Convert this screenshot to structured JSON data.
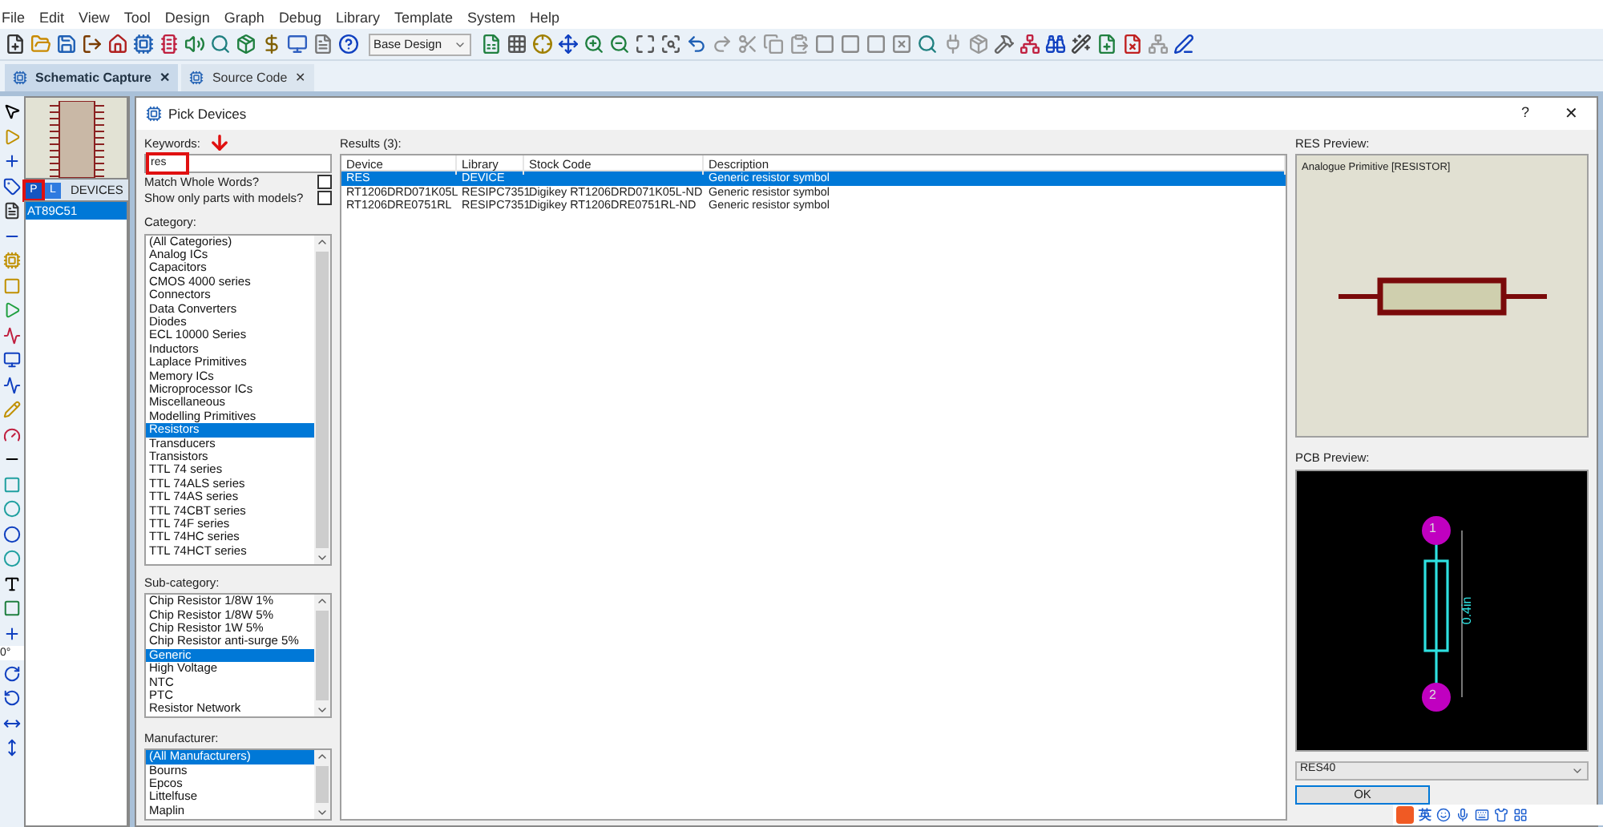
{
  "menu": [
    {
      "label": "File"
    },
    {
      "label": "Edit"
    },
    {
      "label": "View"
    },
    {
      "label": "Tool"
    },
    {
      "label": "Design"
    },
    {
      "label": "Graph"
    },
    {
      "label": "Debug"
    },
    {
      "label": "Library"
    },
    {
      "label": "Template"
    },
    {
      "label": "System"
    },
    {
      "label": "Help"
    }
  ],
  "toolbar": {
    "design_select": "Base Design"
  },
  "tabs": [
    {
      "label": "Schematic Capture",
      "selected": true,
      "close": "✕"
    },
    {
      "label": "Source Code",
      "selected": false,
      "close": "✕"
    }
  ],
  "devices_panel": {
    "modes": [
      {
        "label": "P",
        "selected": true
      },
      {
        "label": "L",
        "selected": false
      }
    ],
    "title": "DEVICES",
    "items": [
      {
        "label": "AT89C51",
        "selected": true
      }
    ],
    "rotation": "0°"
  },
  "dialog": {
    "title": "Pick Devices",
    "help": "?",
    "close": "✕",
    "keywords": {
      "label": "Keywords:",
      "value": "res"
    },
    "options": [
      {
        "label": "Match Whole Words?",
        "checked": false
      },
      {
        "label": "Show only parts with models?",
        "checked": false
      }
    ],
    "category": {
      "label": "Category:",
      "items": [
        {
          "label": "(All Categories)",
          "selected": false
        },
        {
          "label": "Analog ICs",
          "selected": false
        },
        {
          "label": "Capacitors",
          "selected": false
        },
        {
          "label": "CMOS 4000 series",
          "selected": false
        },
        {
          "label": "Connectors",
          "selected": false
        },
        {
          "label": "Data Converters",
          "selected": false
        },
        {
          "label": "Diodes",
          "selected": false
        },
        {
          "label": "ECL 10000 Series",
          "selected": false
        },
        {
          "label": "Inductors",
          "selected": false
        },
        {
          "label": "Laplace Primitives",
          "selected": false
        },
        {
          "label": "Memory ICs",
          "selected": false
        },
        {
          "label": "Microprocessor ICs",
          "selected": false
        },
        {
          "label": "Miscellaneous",
          "selected": false
        },
        {
          "label": "Modelling Primitives",
          "selected": false
        },
        {
          "label": "Resistors",
          "selected": true
        },
        {
          "label": "Transducers",
          "selected": false
        },
        {
          "label": "Transistors",
          "selected": false
        },
        {
          "label": "TTL 74 series",
          "selected": false
        },
        {
          "label": "TTL 74ALS series",
          "selected": false
        },
        {
          "label": "TTL 74AS series",
          "selected": false
        },
        {
          "label": "TTL 74CBT series",
          "selected": false
        },
        {
          "label": "TTL 74F series",
          "selected": false
        },
        {
          "label": "TTL 74HC series",
          "selected": false
        },
        {
          "label": "TTL 74HCT series",
          "selected": false
        }
      ]
    },
    "subcategory": {
      "label": "Sub-category:",
      "items": [
        {
          "label": "Chip Resistor 1/8W 1%",
          "selected": false
        },
        {
          "label": "Chip Resistor 1/8W 5%",
          "selected": false
        },
        {
          "label": "Chip Resistor 1W 5%",
          "selected": false
        },
        {
          "label": "Chip Resistor anti-surge 5%",
          "selected": false
        },
        {
          "label": "Generic",
          "selected": true
        },
        {
          "label": "High Voltage",
          "selected": false
        },
        {
          "label": "NTC",
          "selected": false
        },
        {
          "label": "PTC",
          "selected": false
        },
        {
          "label": "Resistor Network",
          "selected": false
        }
      ]
    },
    "manufacturer": {
      "label": "Manufacturer:",
      "items": [
        {
          "label": "(All Manufacturers)",
          "selected": true
        },
        {
          "label": "Bourns",
          "selected": false
        },
        {
          "label": "Epcos",
          "selected": false
        },
        {
          "label": "Littelfuse",
          "selected": false
        },
        {
          "label": "Maplin",
          "selected": false
        }
      ]
    },
    "results": {
      "label": "Results (3):",
      "columns": [
        "Device",
        "Library",
        "Stock Code",
        "Description"
      ],
      "rows": [
        {
          "cells": [
            "RES",
            "DEVICE",
            "",
            "Generic resistor symbol"
          ],
          "selected": true
        },
        {
          "cells": [
            "RT1206DRD071K05L",
            "RESIPC7351",
            "Digikey RT1206DRD071K05L-ND",
            "Generic resistor symbol"
          ],
          "selected": false
        },
        {
          "cells": [
            "RT1206DRE0751RL",
            "RESIPC7351",
            "Digikey RT1206DRE0751RL-ND",
            "Generic resistor symbol"
          ],
          "selected": false
        }
      ]
    },
    "res_preview": {
      "label": "RES Preview:",
      "caption": "Analogue Primitive [RESISTOR]"
    },
    "pcb_preview": {
      "label": "PCB Preview:",
      "pins": [
        "1",
        "2"
      ],
      "dimension": "0.4in"
    },
    "package": "RES40",
    "ok": "OK"
  },
  "ime_bar": {
    "mode": "英"
  }
}
